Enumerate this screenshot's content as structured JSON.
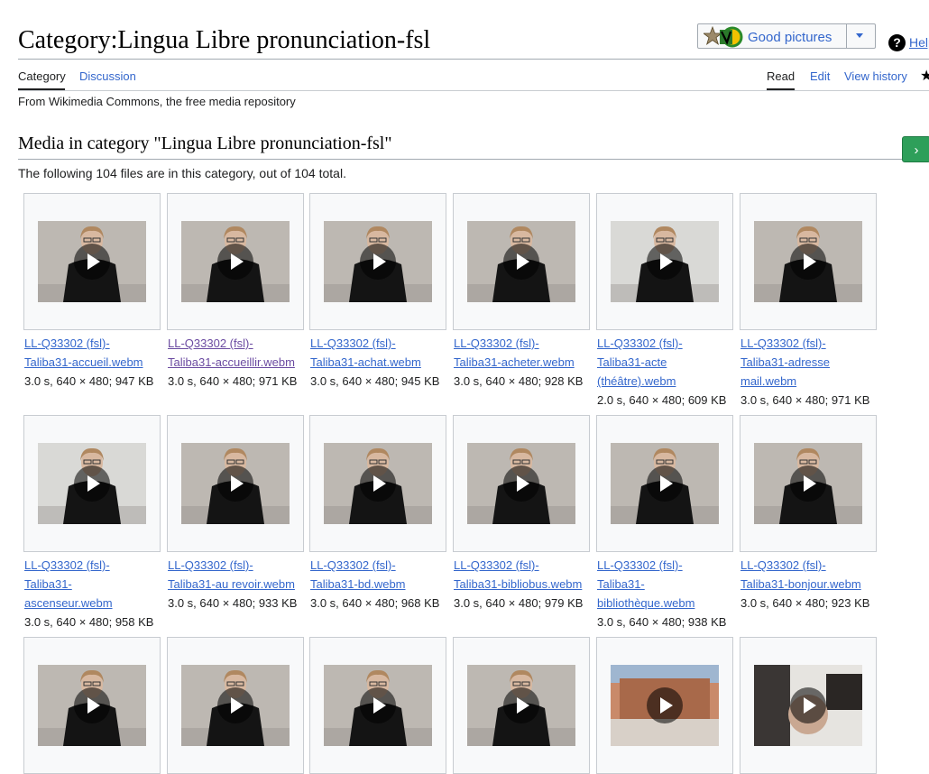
{
  "header": {
    "title": "Category:Lingua Libre pronunciation-fsl",
    "good_pictures_label": "Good pictures",
    "help_label": "Help"
  },
  "tabs": {
    "left": [
      {
        "label": "Category",
        "active": true
      },
      {
        "label": "Discussion",
        "active": false
      }
    ],
    "right": [
      {
        "label": "Read",
        "active": true
      },
      {
        "label": "Edit",
        "active": false
      },
      {
        "label": "View history",
        "active": false
      }
    ]
  },
  "tagline": "From Wikimedia Commons, the free media repository",
  "media": {
    "heading": "Media in category \"Lingua Libre pronunciation-fsl\"",
    "count_text": "The following 104 files are in this category, out of 104 total.",
    "next_label": "›"
  },
  "gallery": [
    {
      "name_lines": [
        "LL-Q33302 (fsl)-",
        "Taliba31-accueil.webm"
      ],
      "meta": "3.0 s, 640 × 480; 947 KB",
      "visited": false
    },
    {
      "name_lines": [
        "LL-Q33302 (fsl)-",
        "Taliba31-accueillir.webm"
      ],
      "meta": "3.0 s, 640 × 480; 971 KB",
      "visited": true
    },
    {
      "name_lines": [
        "LL-Q33302 (fsl)-",
        "Taliba31-achat.webm"
      ],
      "meta": "3.0 s, 640 × 480; 945 KB",
      "visited": false
    },
    {
      "name_lines": [
        "LL-Q33302 (fsl)-",
        "Taliba31-acheter.webm"
      ],
      "meta": "3.0 s, 640 × 480; 928 KB",
      "visited": false
    },
    {
      "name_lines": [
        "LL-Q33302 (fsl)-",
        "Taliba31-acte",
        "(théâtre).webm"
      ],
      "meta": "2.0 s, 640 × 480; 609 KB",
      "visited": false
    },
    {
      "name_lines": [
        "LL-Q33302 (fsl)-",
        "Taliba31-adresse",
        "mail.webm"
      ],
      "meta": "3.0 s, 640 × 480; 971 KB",
      "visited": false
    },
    {
      "name_lines": [
        "LL-Q33302 (fsl)-",
        "Taliba31-",
        "ascenseur.webm"
      ],
      "meta": "3.0 s, 640 × 480; 958 KB",
      "visited": false
    },
    {
      "name_lines": [
        "LL-Q33302 (fsl)-",
        "Taliba31-au revoir.webm"
      ],
      "meta": "3.0 s, 640 × 480; 933 KB",
      "visited": false
    },
    {
      "name_lines": [
        "LL-Q33302 (fsl)-",
        "Taliba31-bd.webm"
      ],
      "meta": "3.0 s, 640 × 480; 968 KB",
      "visited": false
    },
    {
      "name_lines": [
        "LL-Q33302 (fsl)-",
        "Taliba31-bibliobus.webm"
      ],
      "meta": "3.0 s, 640 × 480; 979 KB",
      "visited": false
    },
    {
      "name_lines": [
        "LL-Q33302 (fsl)-",
        "Taliba31-",
        "bibliothèque.webm"
      ],
      "meta": "3.0 s, 640 × 480; 938 KB",
      "visited": false
    },
    {
      "name_lines": [
        "LL-Q33302 (fsl)-",
        "Taliba31-bonjour.webm"
      ],
      "meta": "3.0 s, 640 × 480; 923 KB",
      "visited": false
    },
    {
      "name_lines": [],
      "meta": "",
      "visited": false
    },
    {
      "name_lines": [],
      "meta": "",
      "visited": false
    },
    {
      "name_lines": [],
      "meta": "",
      "visited": false
    },
    {
      "name_lines": [],
      "meta": "",
      "visited": false
    },
    {
      "name_lines": [],
      "meta": "",
      "visited": false
    },
    {
      "name_lines": [],
      "meta": "",
      "visited": false
    }
  ],
  "colors": {
    "link": "#3366cc",
    "visited_link": "#6b4ba1",
    "next_button": "#2e9f5a"
  }
}
